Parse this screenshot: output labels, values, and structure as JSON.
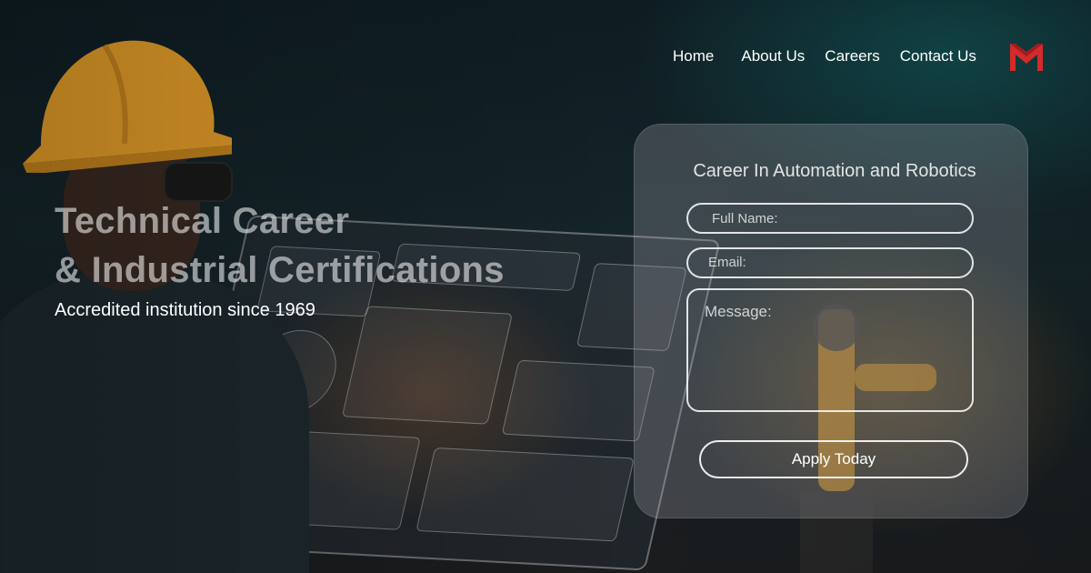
{
  "nav": {
    "items": [
      "Home",
      "About Us",
      "Careers",
      "Contact Us"
    ],
    "logo_icon": "m-brand-logo-icon",
    "logo_color": "#d42a2a"
  },
  "hero": {
    "title_line1": "Technical Career",
    "title_line2": "& Industrial Certifications",
    "subtitle": "Accredited institution since 1969"
  },
  "form": {
    "title": "Career In Automation and Robotics",
    "full_name_placeholder": "Full Name:",
    "email_placeholder": "Email:",
    "message_placeholder": "Message:",
    "submit_label": "Apply Today"
  },
  "colors": {
    "helmet": "#e8a02a",
    "accent": "#d42a2a",
    "text": "#ffffff"
  }
}
